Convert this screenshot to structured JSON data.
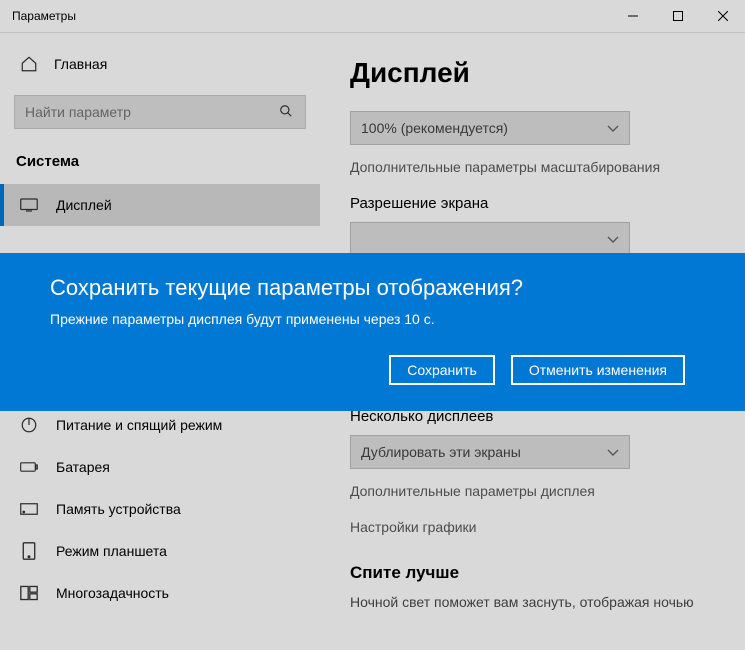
{
  "window": {
    "title": "Параметры"
  },
  "sidebar": {
    "home_label": "Главная",
    "search_placeholder": "Найти параметр",
    "section_title": "Система",
    "items": [
      {
        "label": "Дисплей"
      },
      {
        "label": "Питание и спящий режим"
      },
      {
        "label": "Батарея"
      },
      {
        "label": "Память устройства"
      },
      {
        "label": "Режим планшета"
      },
      {
        "label": "Многозадачность"
      }
    ]
  },
  "main": {
    "heading": "Дисплей",
    "scale_dropdown": "100% (рекомендуется)",
    "advanced_scaling_link": "Дополнительные параметры масштабирования",
    "resolution_label": "Разрешение экрана",
    "multi_display_label": "Несколько дисплеев",
    "multi_display_value": "Дублировать эти экраны",
    "advanced_display_link": "Дополнительные параметры дисплея",
    "graphics_link": "Настройки графики",
    "sleep_heading": "Спите лучше",
    "sleep_body": "Ночной свет поможет вам заснуть, отображая ночью"
  },
  "dialog": {
    "title": "Сохранить текущие параметры отображения?",
    "body": "Прежние параметры дисплея будут применены через 10 с.",
    "save_label": "Сохранить",
    "cancel_label": "Отменить изменения"
  }
}
